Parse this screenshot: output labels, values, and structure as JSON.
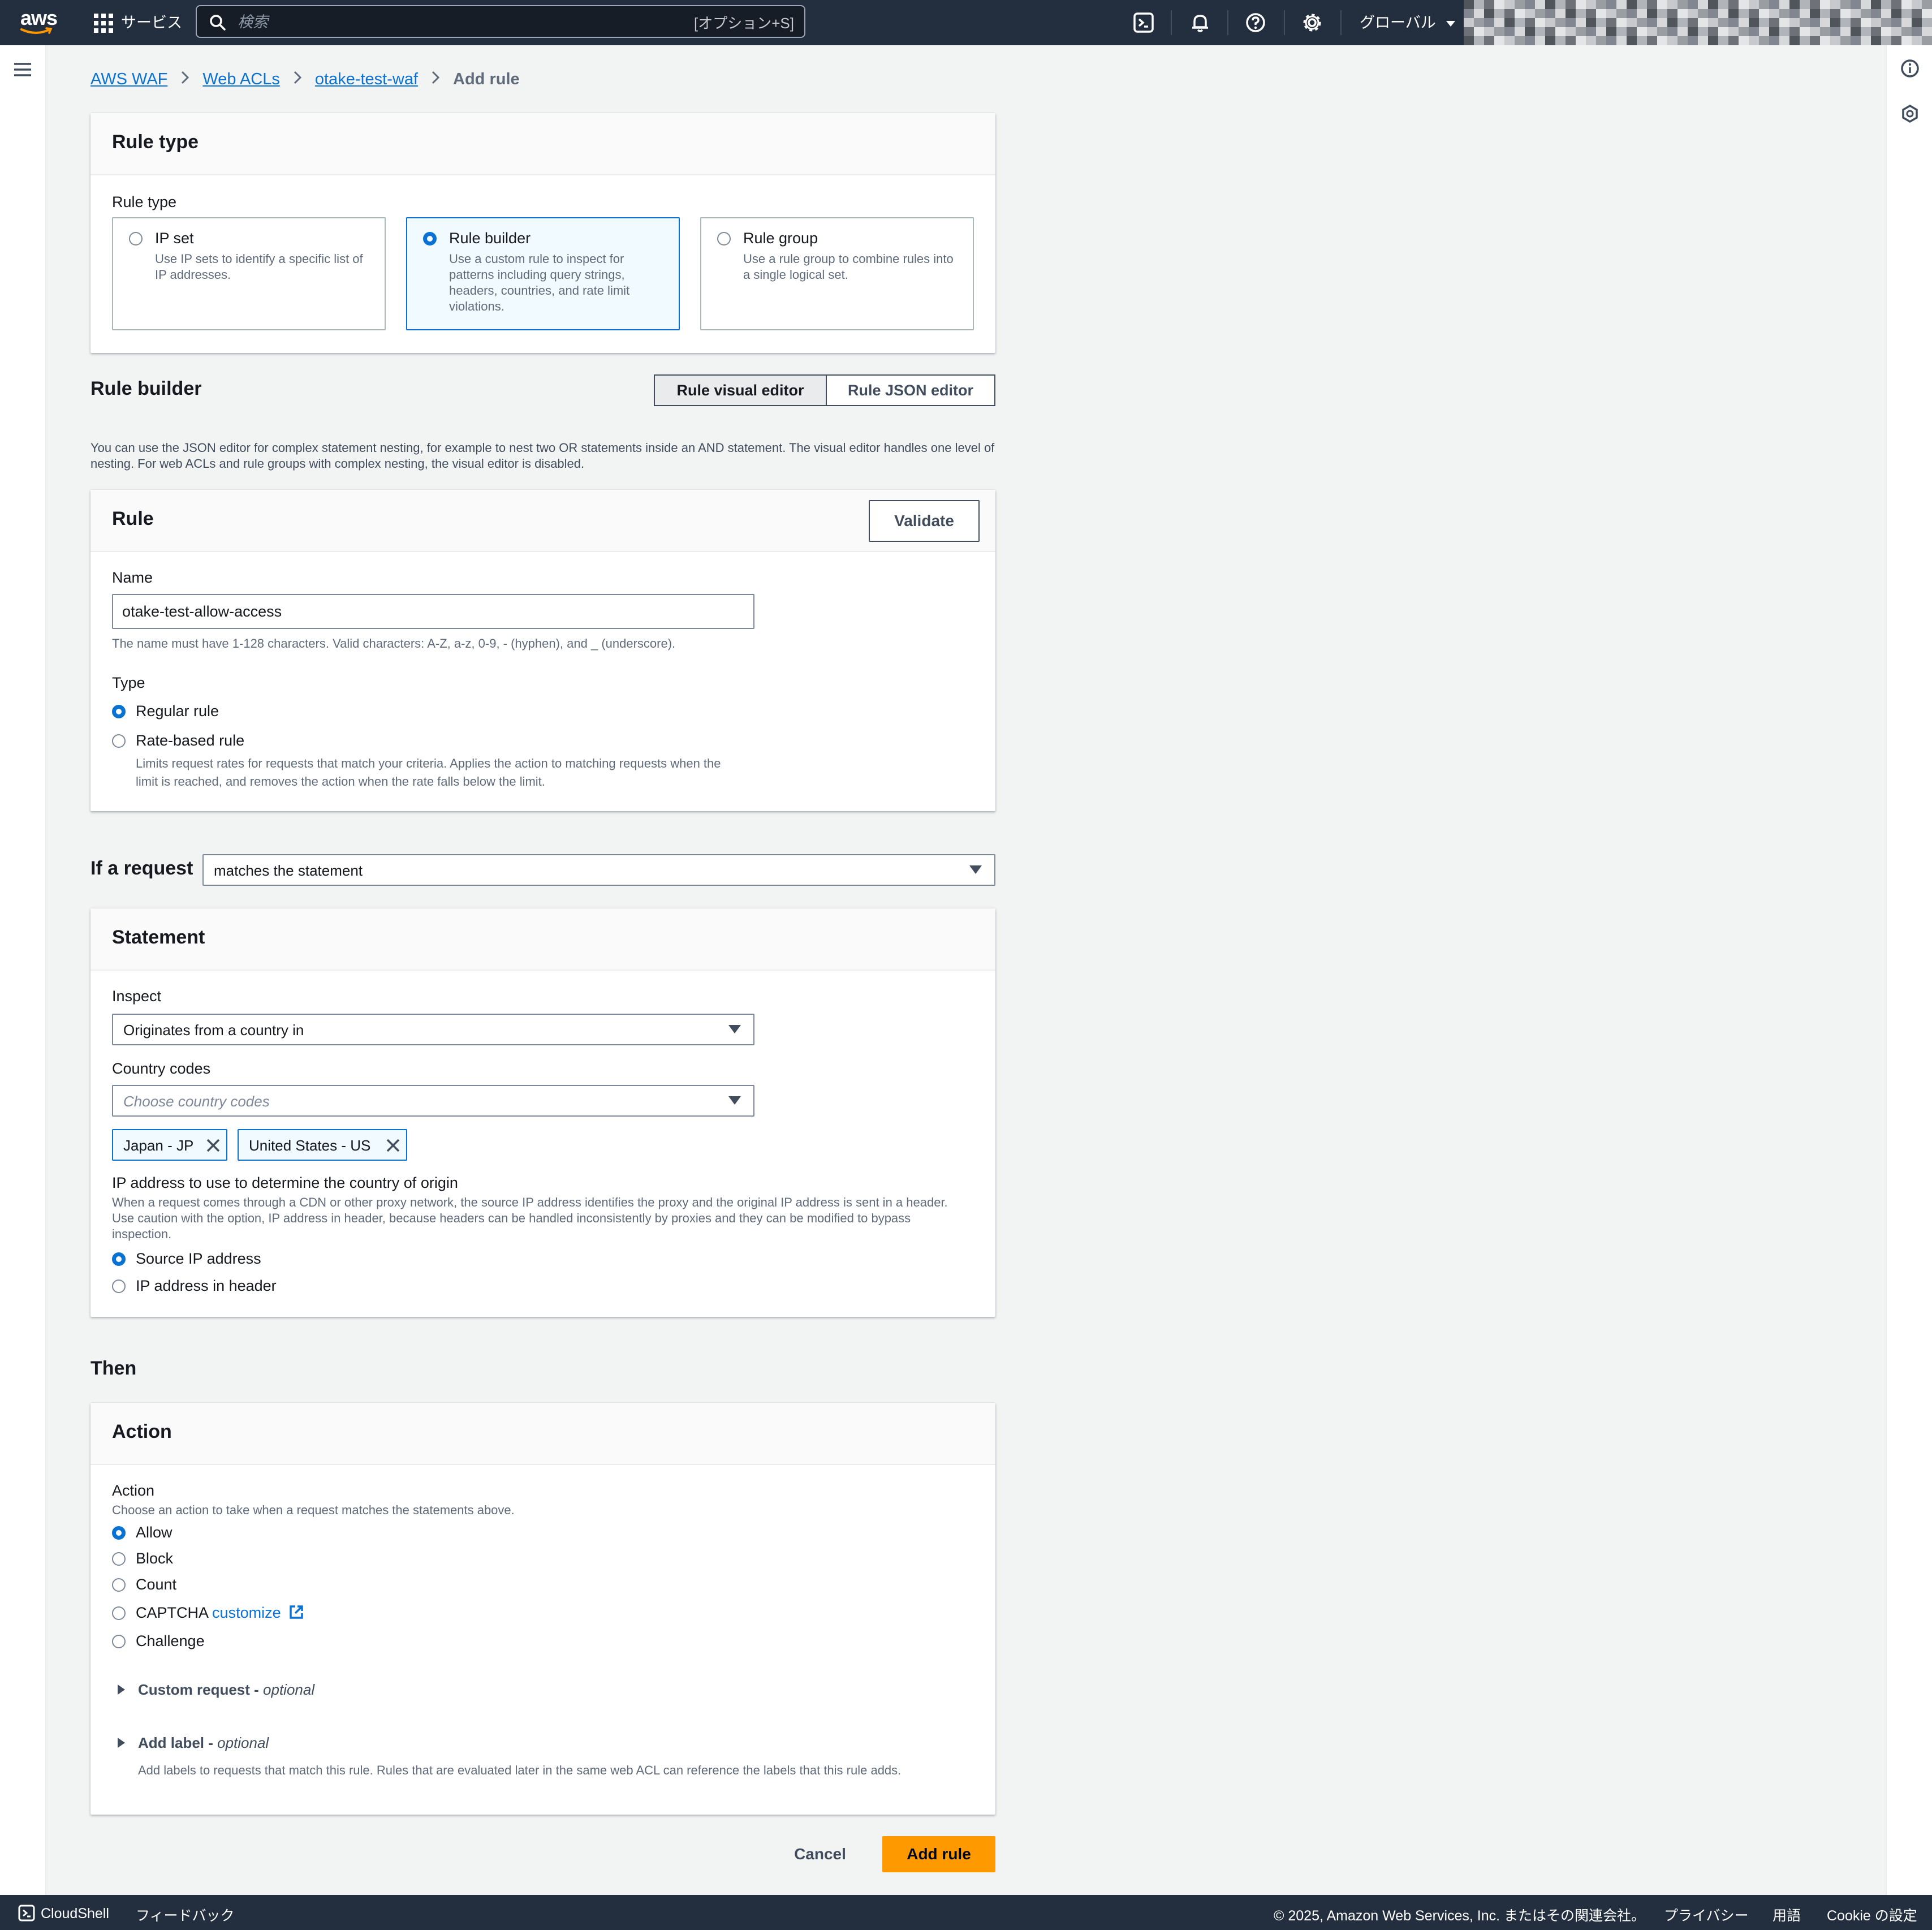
{
  "topnav": {
    "logo_text": "aws",
    "services_label": "サービス",
    "search_placeholder": "検索",
    "search_shortcut": "[オプション+S]",
    "region_label": "グローバル"
  },
  "breadcrumb": {
    "items": [
      "AWS WAF",
      "Web ACLs",
      "otake-test-waf"
    ],
    "current": "Add rule"
  },
  "rule_type": {
    "header": "Rule type",
    "field_label": "Rule type",
    "options": [
      {
        "title": "IP set",
        "description": "Use IP sets to identify a specific list of IP addresses.",
        "selected": false
      },
      {
        "title": "Rule builder",
        "description": "Use a custom rule to inspect for patterns including query strings, headers, countries, and rate limit violations.",
        "selected": true
      },
      {
        "title": "Rule group",
        "description": "Use a rule group to combine rules into a single logical set.",
        "selected": false
      }
    ]
  },
  "rule_builder": {
    "title": "Rule builder",
    "editor_tabs": [
      "Rule visual editor",
      "Rule JSON editor"
    ],
    "active_tab": "Rule visual editor",
    "description": "You can use the JSON editor for complex statement nesting, for example to nest two OR statements inside an AND statement. The visual editor handles one level of nesting. For web ACLs and rule groups with complex nesting, the visual editor is disabled."
  },
  "rule": {
    "header": "Rule",
    "validate_label": "Validate",
    "name_label": "Name",
    "name_value": "otake-test-allow-access",
    "name_hint": "The name must have 1-128 characters. Valid characters: A-Z, a-z, 0-9, - (hyphen), and _ (underscore).",
    "type_label": "Type",
    "type_options": [
      {
        "label": "Regular rule",
        "selected": true
      },
      {
        "label": "Rate-based rule",
        "selected": false,
        "description": "Limits request rates for requests that match your criteria. Applies the action to matching requests when the limit is reached, and removes the action when the rate falls below the limit."
      }
    ]
  },
  "if_request": {
    "label": "If a request",
    "selected": "matches the statement"
  },
  "statement": {
    "header": "Statement",
    "inspect_label": "Inspect",
    "inspect_value": "Originates from a country in",
    "country_codes_label": "Country codes",
    "country_codes_placeholder": "Choose country codes",
    "tokens": [
      "Japan - JP",
      "United States - US"
    ],
    "ip_label": "IP address to use to determine the country of origin",
    "ip_description": "When a request comes through a CDN or other proxy network, the source IP address identifies the proxy and the original IP address is sent in a header. Use caution with the option, IP address in header, because headers can be handled inconsistently by proxies and they can be modified to bypass inspection.",
    "ip_options": [
      {
        "label": "Source IP address",
        "selected": true
      },
      {
        "label": "IP address in header",
        "selected": false
      }
    ]
  },
  "then_label": "Then",
  "action": {
    "header": "Action",
    "field_label": "Action",
    "field_description": "Choose an action to take when a request matches the statements above.",
    "options": [
      {
        "label": "Allow",
        "selected": true
      },
      {
        "label": "Block",
        "selected": false
      },
      {
        "label": "Count",
        "selected": false
      },
      {
        "label": "CAPTCHA",
        "selected": false,
        "link": "customize"
      },
      {
        "label": "Challenge",
        "selected": false
      }
    ],
    "custom_request": {
      "title": "Custom request - ",
      "optional": "optional"
    },
    "add_label": {
      "title": "Add label - ",
      "optional": "optional",
      "description": "Add labels to requests that match this rule. Rules that are evaluated later in the same web ACL can reference the labels that this rule adds."
    }
  },
  "buttons": {
    "cancel": "Cancel",
    "add_rule": "Add rule"
  },
  "footer": {
    "cloudshell": "CloudShell",
    "feedback": "フィードバック",
    "copyright": "© 2025, Amazon Web Services, Inc. またはその関連会社。",
    "privacy": "プライバシー",
    "terms": "用語",
    "cookie": "Cookie の設定"
  },
  "colors": {
    "nav_bg": "#232f3e",
    "accent": "#0972d3",
    "primary": "#ff9900",
    "page_bg": "#f2f3f3"
  }
}
